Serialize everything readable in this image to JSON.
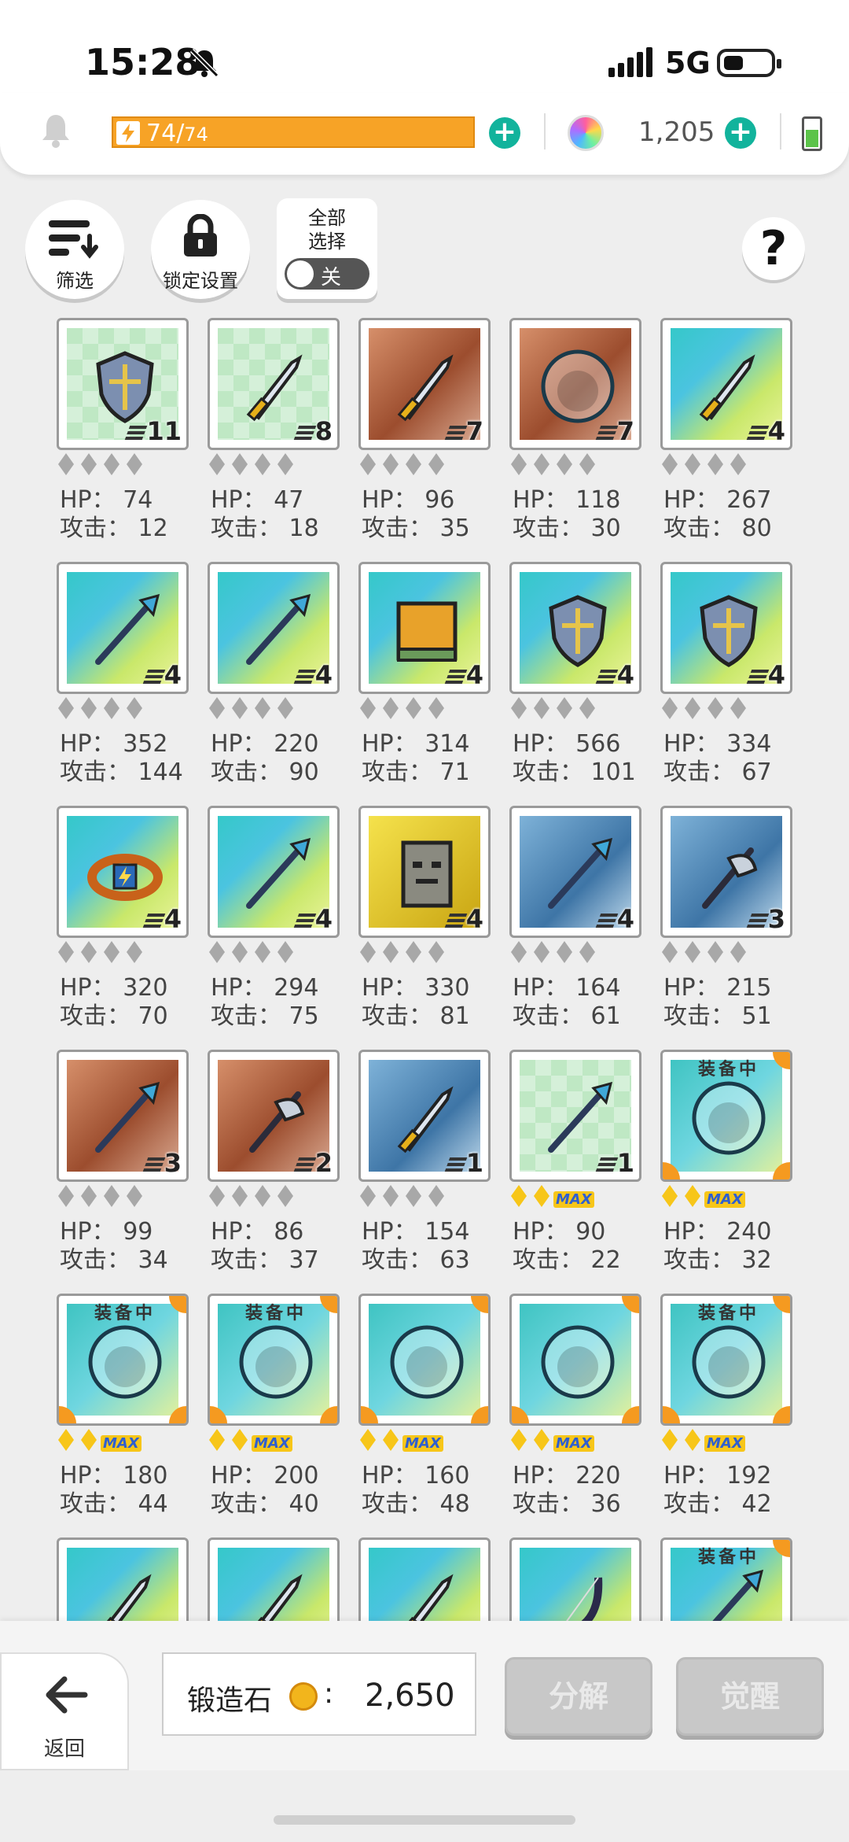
{
  "status": {
    "time": "15:28",
    "network": "5G"
  },
  "resources": {
    "energy_current": "74",
    "energy_max": "74",
    "gems": "1,205"
  },
  "controls": {
    "filter_label": "筛选",
    "lock_label": "锁定设置",
    "select_all_label": "全部\n选择",
    "select_all_toggle": "关",
    "help": "?"
  },
  "stat_labels": {
    "hp": "HP：",
    "attack": "攻击："
  },
  "equipped_label": "装备中",
  "items": [
    {
      "count": "11",
      "hp": "74",
      "atk": "12",
      "bg": "green",
      "icon": "shield-icon",
      "stars": "grey"
    },
    {
      "count": "8",
      "hp": "47",
      "atk": "18",
      "bg": "green",
      "icon": "dagger-icon",
      "stars": "grey"
    },
    {
      "count": "7",
      "hp": "96",
      "atk": "35",
      "bg": "copper",
      "icon": "sword-icon",
      "stars": "grey"
    },
    {
      "count": "7",
      "hp": "118",
      "atk": "30",
      "bg": "copper",
      "icon": "gauntlet-icon",
      "stars": "grey"
    },
    {
      "count": "4",
      "hp": "267",
      "atk": "80",
      "bg": "rainbow",
      "icon": "curved-sword-icon",
      "stars": "grey"
    },
    {
      "count": "4",
      "hp": "352",
      "atk": "144",
      "bg": "rainbow",
      "icon": "trident-icon",
      "stars": "grey"
    },
    {
      "count": "4",
      "hp": "220",
      "atk": "90",
      "bg": "rainbow",
      "icon": "spear-icon",
      "stars": "grey"
    },
    {
      "count": "4",
      "hp": "314",
      "atk": "71",
      "bg": "rainbow",
      "icon": "tome-icon",
      "stars": "grey"
    },
    {
      "count": "4",
      "hp": "566",
      "atk": "101",
      "bg": "rainbow",
      "icon": "dark-shield-icon",
      "stars": "grey"
    },
    {
      "count": "4",
      "hp": "334",
      "atk": "67",
      "bg": "rainbow",
      "icon": "golden-shield-icon",
      "stars": "grey"
    },
    {
      "count": "4",
      "hp": "320",
      "atk": "70",
      "bg": "rainbow",
      "icon": "belt-icon",
      "stars": "grey"
    },
    {
      "count": "4",
      "hp": "294",
      "atk": "75",
      "bg": "rainbow",
      "icon": "rifle-icon",
      "stars": "grey"
    },
    {
      "count": "4",
      "hp": "330",
      "atk": "81",
      "bg": "gold",
      "icon": "stone-tablet-icon",
      "stars": "grey"
    },
    {
      "count": "4",
      "hp": "164",
      "atk": "61",
      "bg": "blue",
      "icon": "red-spear-icon",
      "stars": "grey"
    },
    {
      "count": "3",
      "hp": "215",
      "atk": "51",
      "bg": "blue",
      "icon": "scythe-icon",
      "stars": "grey"
    },
    {
      "count": "3",
      "hp": "99",
      "atk": "34",
      "bg": "copper",
      "icon": "staff-icon",
      "stars": "grey"
    },
    {
      "count": "2",
      "hp": "86",
      "atk": "37",
      "bg": "copper",
      "icon": "axe-icon",
      "stars": "grey"
    },
    {
      "count": "1",
      "hp": "154",
      "atk": "63",
      "bg": "blue",
      "icon": "broadsword-icon",
      "stars": "grey"
    },
    {
      "count": "1",
      "hp": "90",
      "atk": "22",
      "bg": "green",
      "icon": "wand-icon",
      "stars": "max"
    },
    {
      "count": "",
      "hp": "240",
      "atk": "32",
      "bg": "cyan",
      "icon": "forest-orb-icon",
      "stars": "max",
      "equipped": true
    },
    {
      "count": "",
      "hp": "180",
      "atk": "44",
      "bg": "cyan",
      "icon": "desert-orb-icon",
      "stars": "max",
      "equipped": true
    },
    {
      "count": "",
      "hp": "200",
      "atk": "40",
      "bg": "cyan",
      "icon": "ocean-orb-icon",
      "stars": "max",
      "equipped": true
    },
    {
      "count": "",
      "hp": "160",
      "atk": "48",
      "bg": "cyan",
      "icon": "rock-orb-icon",
      "stars": "max"
    },
    {
      "count": "",
      "hp": "220",
      "atk": "36",
      "bg": "cyan",
      "icon": "ice-orb-icon",
      "stars": "max"
    },
    {
      "count": "",
      "hp": "192",
      "atk": "42",
      "bg": "cyan",
      "icon": "crystal-orb-icon",
      "stars": "max",
      "equipped": true
    },
    {
      "count": "",
      "hp": "",
      "atk": "",
      "bg": "rainbow",
      "icon": "blade-icon",
      "stars": "none"
    },
    {
      "count": "",
      "hp": "",
      "atk": "",
      "bg": "rainbow",
      "icon": "holy-sword-icon",
      "stars": "none"
    },
    {
      "count": "",
      "hp": "",
      "atk": "",
      "bg": "rainbow",
      "icon": "ruby-sword-icon",
      "stars": "none"
    },
    {
      "count": "",
      "hp": "",
      "atk": "",
      "bg": "rainbow",
      "icon": "bow-icon",
      "stars": "none"
    },
    {
      "count": "",
      "hp": "",
      "atk": "",
      "bg": "rainbow",
      "icon": "crossbow-icon",
      "stars": "none",
      "equipped": true
    }
  ],
  "max_label": "MAX",
  "bottom": {
    "back_label": "返回",
    "forge_label": "锻造石",
    "forge_colon": ":",
    "forge_value": "2,650",
    "decompose_label": "分解",
    "awaken_label": "觉醒"
  },
  "colors": {
    "accent_teal": "#12b39c",
    "energy_orange": "#f7a326",
    "star_gold": "#f7c619",
    "disabled_button": "#c8c8c8"
  }
}
